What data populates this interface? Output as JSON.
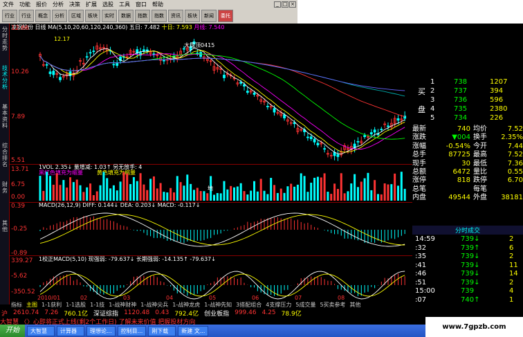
{
  "menu": [
    "文件",
    "功能",
    "报价",
    "分析",
    "决策",
    "扩展",
    "选股",
    "工具",
    "窗口",
    "帮助"
  ],
  "toolbar": [
    "行业",
    "行业",
    "概念",
    "分析",
    "区域",
    "板块",
    "实时",
    "数据",
    "指数",
    "指数",
    "资讯",
    "板块",
    "新闻",
    "委托"
  ],
  "left_tabs": [
    "分时走势",
    "技术分析",
    "基本资料",
    "综合排名",
    "财务",
    "其他"
  ],
  "chart": {
    "stock": "凌钢股份",
    "period": "日线",
    "ma_label": "MA(5,10,20,60,120,240,360)",
    "ma5_label": "五日: 7.482",
    "ma10_label": "十日: 7.593",
    "ma20_label": "月线: 7.540",
    "price_axis": [
      "12.66",
      "10.26",
      "7.89",
      "5.51"
    ],
    "hi_label": "12.17",
    "big_label": "大盘顶0415",
    "vol_line": "1VOL 2.35↓ 量增减: 1.03↑ 另无放手: 4",
    "vol_note1": "黑红色填充为缩量",
    "vol_note2": "黄色填充为缩量",
    "vol_axis": [
      "13.71",
      "6.75",
      "0.00"
    ],
    "vol_mark": "地",
    "macd_line": "MACD(26,12,9) DIFF: 0.144↓ DEA: 0.203↓ MACD: -0.117↓",
    "macd_axis": [
      "0.39",
      "-0.25",
      "-0.89"
    ],
    "mcd2_line": "1校正MACD(5,10) 现强弱: -79.637↓ 长期强弱: -14.135↑ -79.637↓",
    "mcd2_axis": [
      "339.27",
      "-5.62",
      "-350.52"
    ],
    "date_axis": [
      "2010/01",
      "02",
      "03",
      "04",
      "05",
      "06",
      "07",
      "08"
    ]
  },
  "quote": {
    "buy_label": "买",
    "sell_label": "盘",
    "levels": [
      {
        "n": "1",
        "p": "738",
        "v": "1207"
      },
      {
        "n": "2",
        "p": "737",
        "v": "394"
      },
      {
        "n": "3",
        "p": "736",
        "v": "596"
      },
      {
        "n": "4",
        "p": "735",
        "v": "2380"
      },
      {
        "n": "5",
        "p": "734",
        "v": "226"
      }
    ],
    "rows": [
      [
        "最新",
        "740",
        "均价",
        "7.52"
      ],
      [
        "涨跌",
        "▼004",
        "换手",
        "2.35%"
      ],
      [
        "涨幅",
        "-0.54%",
        "今开",
        "7.44"
      ],
      [
        "总手",
        "87725",
        "最高",
        "7.52"
      ],
      [
        "现手",
        "30",
        "最低",
        "7.36"
      ],
      [
        "总额",
        "6472",
        "量比",
        "0.55"
      ],
      [
        "涨停",
        "818",
        "跌停",
        "6.70"
      ],
      [
        "总笔",
        "",
        "每笔",
        ""
      ],
      [
        "内盘",
        "49544",
        "外盘",
        "38181"
      ]
    ]
  },
  "ticks": {
    "header": "分时成交",
    "rows": [
      [
        "14:59",
        "739↓",
        "2"
      ],
      [
        ":32",
        "739↑",
        "6"
      ],
      [
        ":35",
        "739↓",
        "2"
      ],
      [
        ":41",
        "739↓",
        "11"
      ],
      [
        ":46",
        "739↓",
        "14"
      ],
      [
        ":51",
        "739↓",
        "2"
      ],
      [
        "15:00",
        "739",
        "4"
      ],
      [
        ":07",
        "740↑",
        "1"
      ]
    ]
  },
  "bottom_tabs": [
    "指标",
    "主图",
    "1-1获利",
    "1-1选股",
    "1-1技",
    "1-战神财神",
    "1-战神尖兵",
    "1-战神龙虎",
    "1-战神先知",
    "3搭配组合",
    "4支撑压力",
    "5成交量",
    "5买卖参考",
    "其他"
  ],
  "index_bar": {
    "market": "沪",
    "v1": "2610.74",
    "v2": "7.26",
    "v3": "760.1亿",
    "name2": "深证综指",
    "v4": "1120.48",
    "v5": "0.43",
    "v6": "792.4亿",
    "name3": "创业板指",
    "v7": "999.46",
    "v8": "4.25",
    "v9": "78.9亿"
  },
  "ticker": "大智慧 〈〉心即将正式上线(剩2个工作日) 了解未来价值 把握投材方向",
  "taskbar": {
    "start": "开始",
    "items": [
      "大智慧",
      "计算器",
      "理想论...",
      "控制目...",
      "刚下载",
      "新建 文..."
    ]
  },
  "watermark": "www.7gpzb.com",
  "colors": {
    "up": "#ff3333",
    "down": "#00ffff",
    "accent": "#ffff00"
  }
}
